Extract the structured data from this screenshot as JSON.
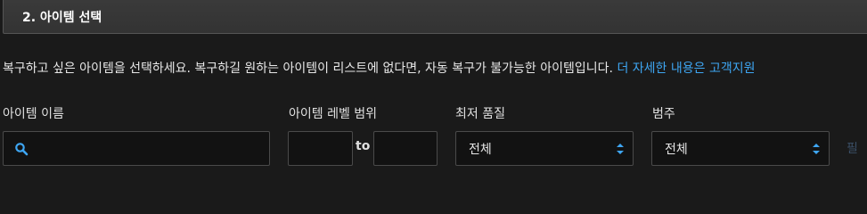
{
  "section": {
    "title": "2. 아이템 선택"
  },
  "description": {
    "text": "복구하고 싶은 아이템을 선택하세요. 복구하길 원하는 아이템이 리스트에 없다면, 자동 복구가 불가능한 아이템입니다. ",
    "link": "더 자세한 내용은 고객지원"
  },
  "filters": {
    "name_label": "아이템 이름",
    "name_value": "",
    "level_label": "아이템 레벨 범위",
    "level_min": "",
    "level_max": "",
    "to_label": "to",
    "quality_label": "최저 품질",
    "quality_value": "전체",
    "category_label": "범주",
    "category_value": "전체",
    "edge_text": "필"
  },
  "colors": {
    "link": "#3ea6f3",
    "icon": "#3ea6f3"
  }
}
